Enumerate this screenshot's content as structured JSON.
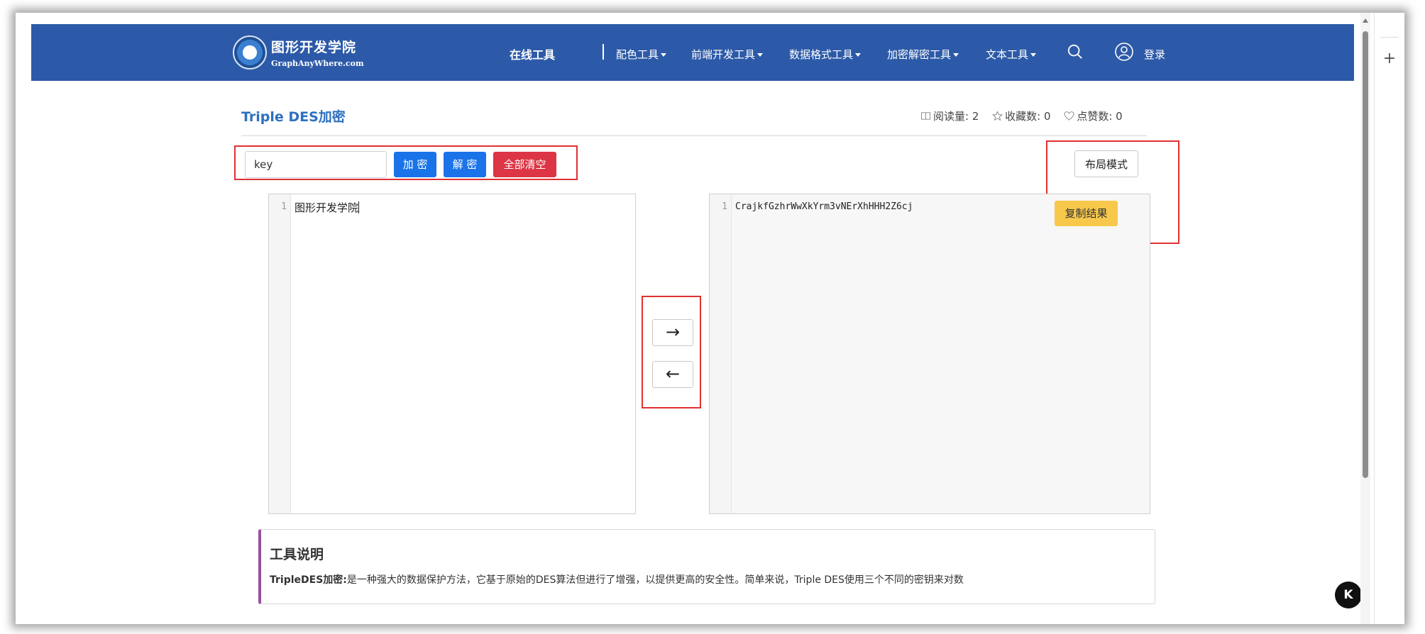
{
  "header": {
    "logo_cn": "图形开发学院",
    "logo_en": "GraphAnyWhere.com",
    "nav_home": "在线工具",
    "nav_items": [
      "配色工具",
      "前端开发工具",
      "数据格式工具",
      "加密解密工具",
      "文本工具"
    ],
    "login": "登录",
    "color": "#2d5aa8"
  },
  "title": {
    "text": "Triple DES加密",
    "views_label": "阅读量: 2",
    "favorites_label": "收藏数: 0",
    "likes_label": "点赞数: 0"
  },
  "toolbar": {
    "key_value": "key",
    "encrypt_label": "加 密",
    "decrypt_label": "解 密",
    "clear_label": "全部清空",
    "layout_label": "布局模式",
    "copy_label": "复制结果"
  },
  "editors": {
    "input_line": "1",
    "input_text": "图形开发学院",
    "output_line": "1",
    "output_text": "CrajkfGzhrWwXkYrm3vNErXhHHH2Z6cj"
  },
  "arrows": {
    "right": "→",
    "left": "←"
  },
  "description": {
    "title": "工具说明",
    "bold": "TripleDES加密:",
    "text": "是一种强大的数据保护方法，它基于原始的DES算法但进行了增强，以提供更高的安全性。简单来说，Triple DES使用三个不同的密钥来对数"
  },
  "sidebar": {
    "plus": "+"
  },
  "badge": {
    "text": "K"
  }
}
